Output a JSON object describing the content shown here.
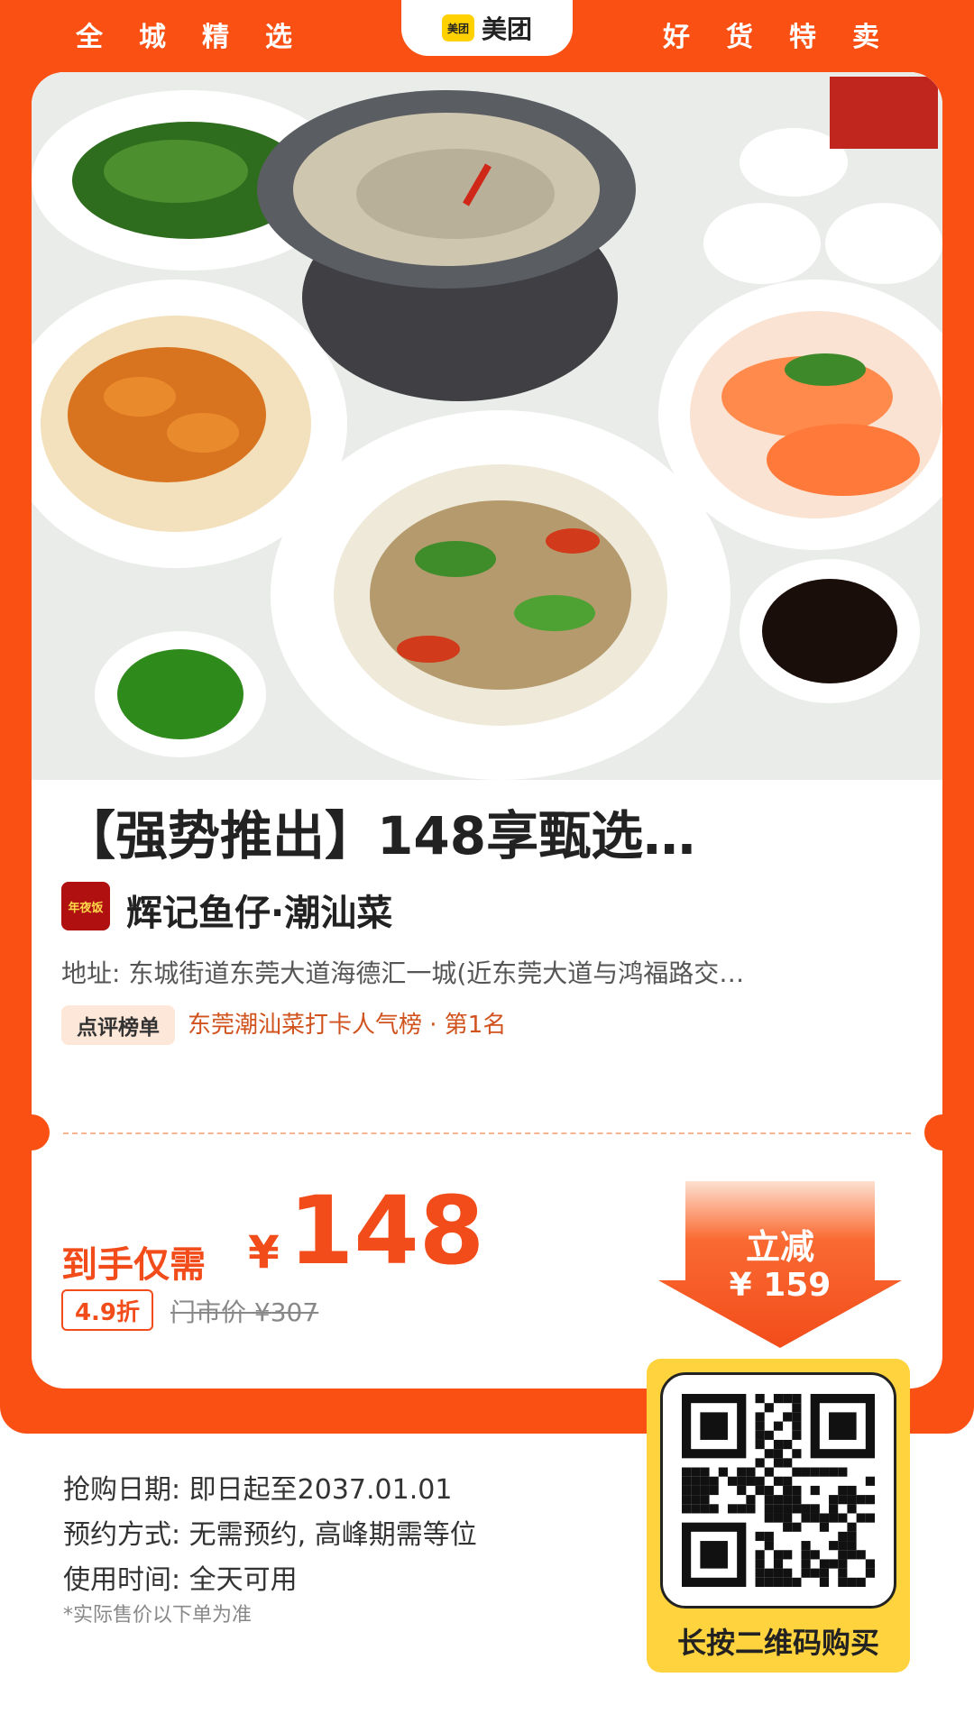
{
  "header": {
    "left_text": "全城精选",
    "brand_logo_text": "美团",
    "brand_name": "美团",
    "right_text": "好货特卖"
  },
  "deal": {
    "photo_icon": "food-photo",
    "title": "【强势推出】148享甄选…",
    "shop_logo_text": "年夜饭",
    "shop_name": "辉记鱼仔·潮汕菜",
    "address": "地址: 东城街道东莞大道海德汇一城(近东莞大道与鸿福路交…",
    "ranking_badge": "点评榜单",
    "ranking_text": "东莞潮汕菜打卡人气榜 · 第1名"
  },
  "price": {
    "label": "到手仅需",
    "currency": "¥",
    "value": "148",
    "discount": "4.9折",
    "original": "门市价 ¥307",
    "savings_label": "立减",
    "savings_amount": "¥ 159"
  },
  "info": {
    "date": "抢购日期: 即日起至2037.01.01",
    "booking": "预约方式: 无需预约, 高峰期需等位",
    "usage": "使用时间: 全天可用",
    "footnote": "*实际售价以下单为准"
  },
  "qr": {
    "caption": "长按二维码购买",
    "icon": "qr-code"
  },
  "colors": {
    "brand_orange": "#fa5014",
    "price_red": "#f24c1a",
    "qr_yellow": "#ffd33d",
    "meituan_yellow": "#ffd100"
  }
}
